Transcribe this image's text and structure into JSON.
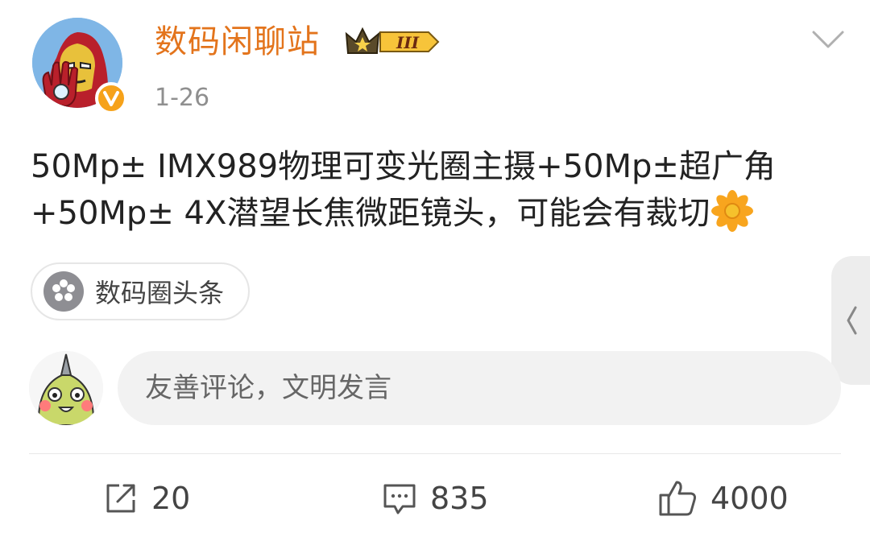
{
  "post": {
    "author": "数码闲聊站",
    "vip_level": "III",
    "date": "1-26",
    "text_lines": [
      "50Mp± IMX989物理可变光圈主摄+50Mp±超广角",
      "+50Mp± 4X潜望长焦微距镜头，可能会有裁切"
    ],
    "topic": "数码圈头条"
  },
  "comment_box": {
    "placeholder": "友善评论，文明发言"
  },
  "actions": {
    "share_count": "20",
    "comment_count": "835",
    "like_count": "4000"
  },
  "icons": {
    "avatar": "iron-man-avatar",
    "verified": "verified-v-icon",
    "vip": "crown-vip-badge",
    "more": "chevron-down-icon",
    "emoji": "sunflower-emoji",
    "topic": "topic-icon",
    "side": "chevron-left-icon",
    "share": "share-icon",
    "comment": "comment-icon",
    "like": "thumbs-up-icon"
  },
  "colors": {
    "username": "#e3741c",
    "verified": "#f6a21a",
    "text": "#222222",
    "muted": "#8f8f8f"
  }
}
